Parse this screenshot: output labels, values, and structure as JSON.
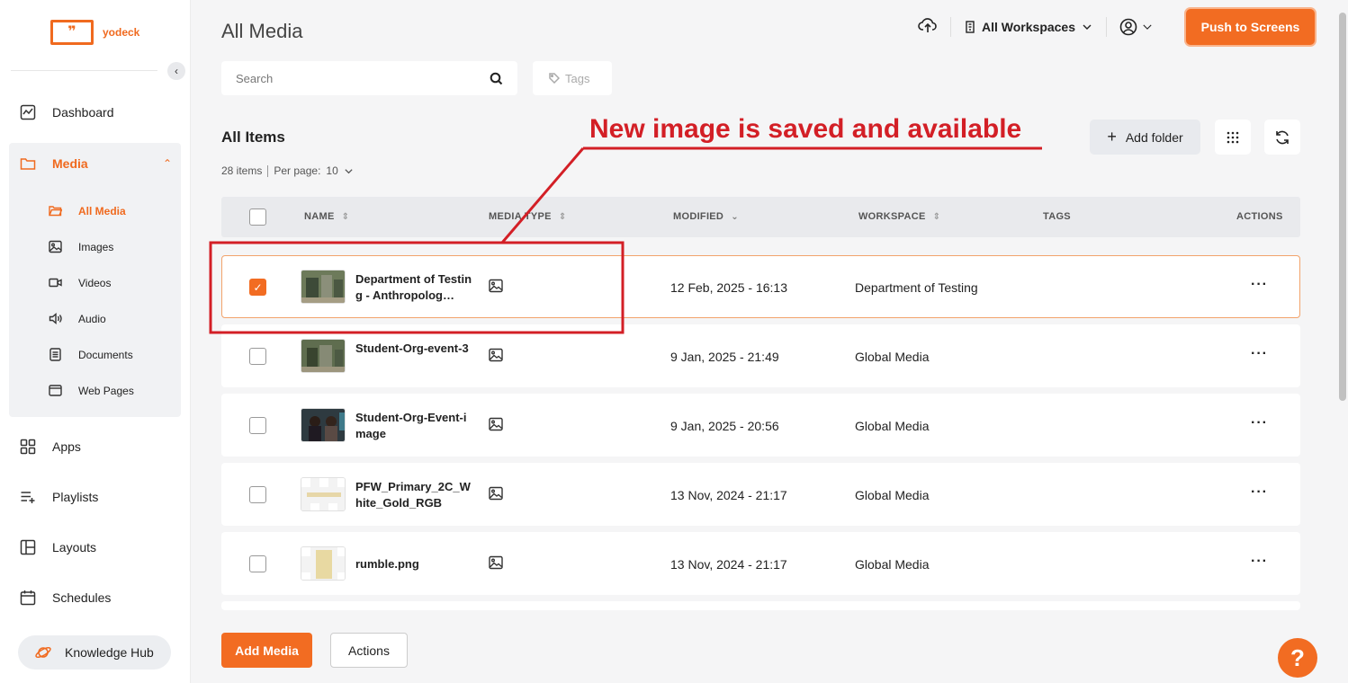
{
  "brand": {
    "logo_mark": "❞",
    "name": "yodeck"
  },
  "sidebar": {
    "collapse_icon": "‹",
    "items": [
      {
        "label": "Dashboard",
        "icon": "dashboard-icon"
      },
      {
        "label": "Apps",
        "icon": "apps-icon"
      },
      {
        "label": "Playlists",
        "icon": "playlists-icon"
      },
      {
        "label": "Layouts",
        "icon": "layouts-icon"
      },
      {
        "label": "Schedules",
        "icon": "schedules-icon"
      }
    ],
    "media": {
      "label": "Media",
      "chevron": "⌃",
      "sub_items": [
        {
          "label": "All Media",
          "active": true
        },
        {
          "label": "Images"
        },
        {
          "label": "Videos"
        },
        {
          "label": "Audio"
        },
        {
          "label": "Documents"
        },
        {
          "label": "Web Pages"
        }
      ]
    },
    "knowledge_hub": "Knowledge Hub"
  },
  "header": {
    "title": "All Media",
    "workspace_select": "All Workspaces",
    "push_button": "Push to Screens"
  },
  "search": {
    "placeholder": "Search"
  },
  "tags_filter": {
    "placeholder": "Tags"
  },
  "list": {
    "title": "All Items",
    "count": "28 items",
    "per_page_label": "Per page:",
    "per_page_value": "10",
    "add_folder": "Add folder",
    "add_folder_icon": "+"
  },
  "annotation": {
    "text": "New image is saved and available"
  },
  "table": {
    "columns": {
      "name": "NAME",
      "media_type": "MEDIA TYPE",
      "modified": "MODIFIED",
      "workspace": "WORKSPACE",
      "tags": "TAGS",
      "actions": "ACTIONS"
    },
    "rows": [
      {
        "name": "Department of Testing - Anthropolog…",
        "modified": "12 Feb, 2025 - 16:13",
        "workspace": "Department of Testing",
        "selected": true
      },
      {
        "name": "Student-Org-event-3",
        "modified": "9 Jan, 2025 - 21:49",
        "workspace": "Global Media",
        "selected": false
      },
      {
        "name": "Student-Org-Event-image",
        "modified": "9 Jan, 2025 - 20:56",
        "workspace": "Global Media",
        "selected": false
      },
      {
        "name": "PFW_Primary_2C_White_Gold_RGB",
        "modified": "13 Nov, 2024 - 21:17",
        "workspace": "Global Media",
        "selected": false
      },
      {
        "name": "rumble.png",
        "modified": "13 Nov, 2024 - 21:17",
        "workspace": "Global Media",
        "selected": false
      }
    ],
    "more_label": "···",
    "check_mark": "✓"
  },
  "footer": {
    "add_media": "Add Media",
    "actions": "Actions",
    "help": "?"
  },
  "colors": {
    "accent": "#f26c22",
    "annotation": "#d31f26"
  }
}
